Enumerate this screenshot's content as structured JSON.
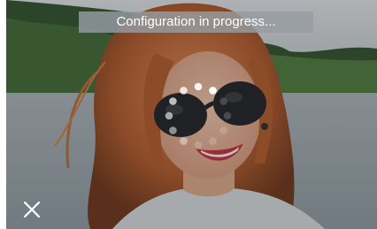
{
  "status": {
    "message": "Configuration in progress..."
  },
  "spinner": {
    "dots": 12,
    "lit_dots": 7
  },
  "icons": {
    "close": "close-icon",
    "loading": "loading-spinner-icon"
  },
  "colors": {
    "banner": "#969ca3",
    "overlay": "#282828",
    "icon": "#ffffff"
  }
}
